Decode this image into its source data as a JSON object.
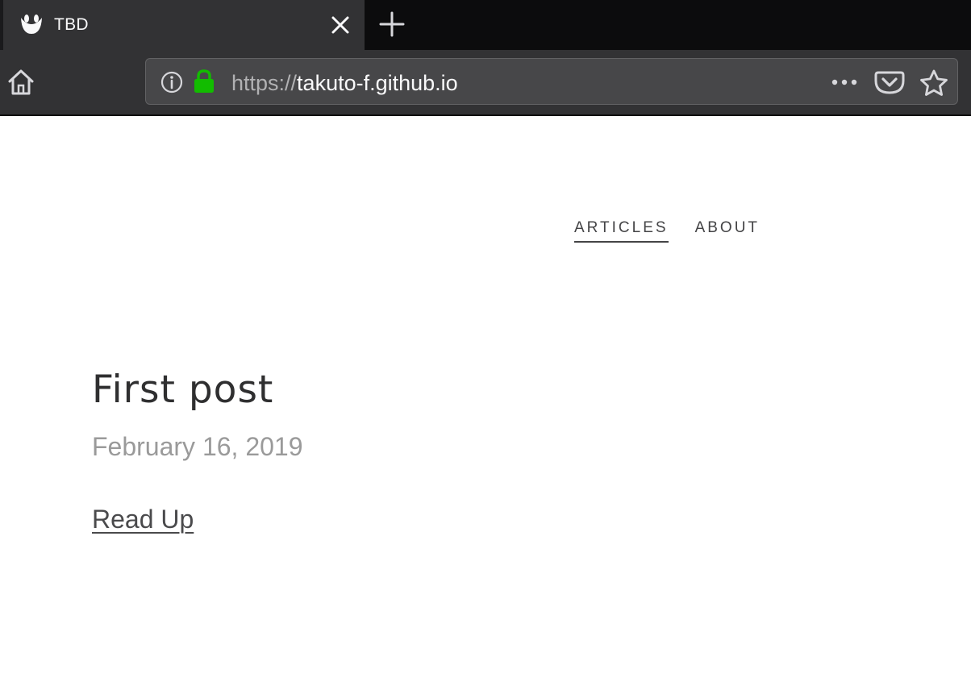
{
  "browser": {
    "tab": {
      "title": "TBD",
      "favicon_icon": "face-smile-icon"
    },
    "toolbar": {
      "home_icon": "home-icon",
      "new_tab_icon": "plus-icon",
      "close_tab_icon": "close-icon"
    },
    "urlbar": {
      "scheme": "https://",
      "host": "takuto-f.github.io",
      "info_icon": "info-icon",
      "lock_icon": "lock-icon",
      "actions": [
        "more-icon",
        "pocket-icon",
        "star-icon"
      ],
      "lock_color": "#12bc00"
    }
  },
  "site": {
    "nav": [
      {
        "label": "ARTICLES",
        "active": true
      },
      {
        "label": "ABOUT",
        "active": false
      }
    ]
  },
  "post": {
    "title": "First post",
    "date": "February 16, 2019",
    "read_link": "Read Up"
  }
}
